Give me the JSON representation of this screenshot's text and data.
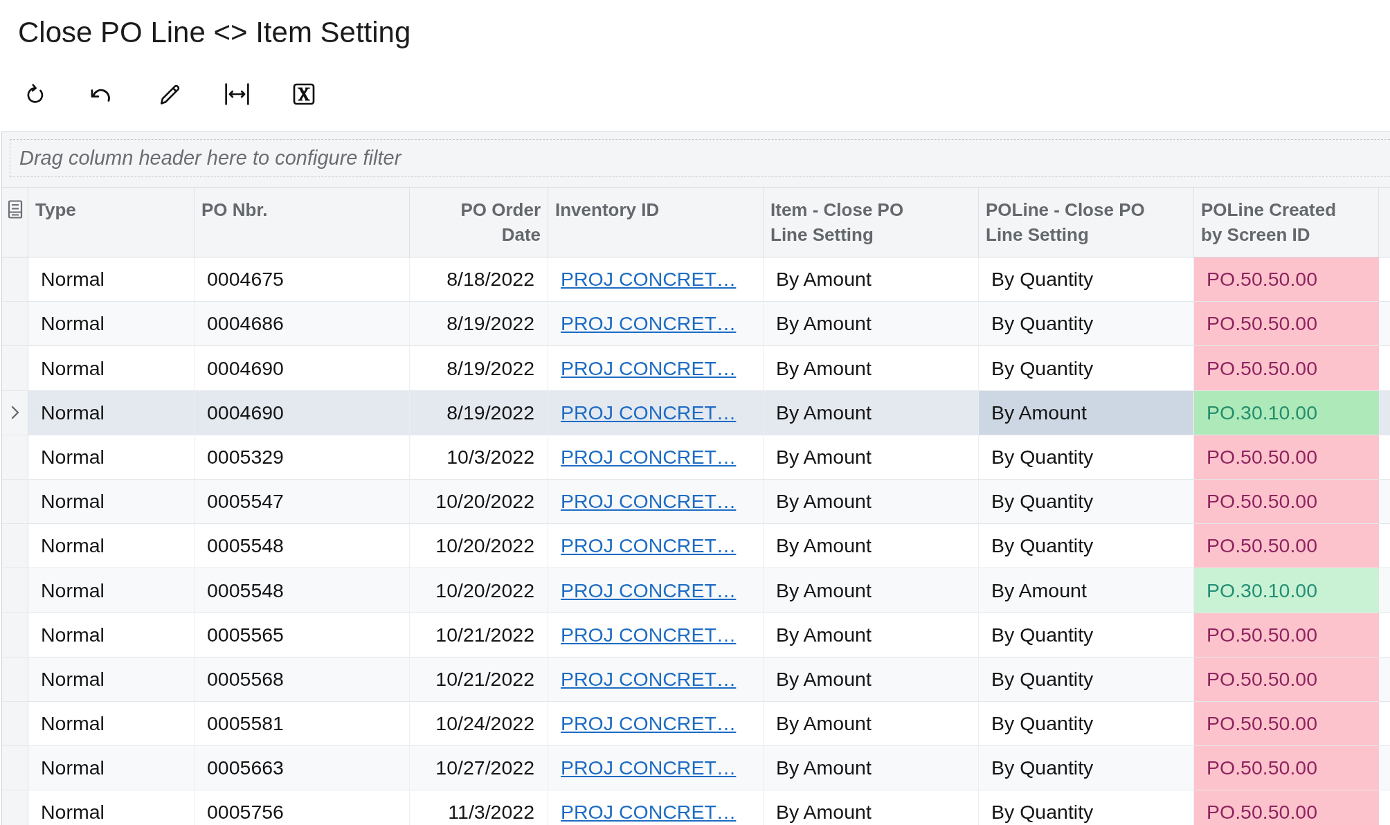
{
  "page": {
    "title": "Close PO Line <> Item Setting"
  },
  "filter_bar": {
    "hint": "Drag column header here to configure filter"
  },
  "grid": {
    "columns": [
      "Type",
      "PO Nbr.",
      "PO Order Date",
      "Inventory ID",
      "Item - Close PO Line Setting",
      "POLine - Close PO Line Setting",
      "POLine Created by Screen ID"
    ],
    "rows": [
      {
        "selected": false,
        "type": "Normal",
        "po_nbr": "0004675",
        "po_order_date": "8/18/2022",
        "inventory_id": "PROJ CONCRET…",
        "item_close_setting": "By Amount",
        "poline_close_setting": "By Quantity",
        "poline_close_focused": false,
        "screen_id": "PO.50.50.00",
        "color": "#fdc3cc"
      },
      {
        "selected": false,
        "type": "Normal",
        "po_nbr": "0004686",
        "po_order_date": "8/19/2022",
        "inventory_id": "PROJ CONCRET…",
        "item_close_setting": "By Amount",
        "poline_close_setting": "By Quantity",
        "poline_close_focused": false,
        "screen_id": "PO.50.50.00",
        "color": "#fdc3cc"
      },
      {
        "selected": false,
        "type": "Normal",
        "po_nbr": "0004690",
        "po_order_date": "8/19/2022",
        "inventory_id": "PROJ CONCRET…",
        "item_close_setting": "By Amount",
        "poline_close_setting": "By Quantity",
        "poline_close_focused": false,
        "screen_id": "PO.50.50.00",
        "color": "#fdc3cc"
      },
      {
        "selected": true,
        "type": "Normal",
        "po_nbr": "0004690",
        "po_order_date": "8/19/2022",
        "inventory_id": "PROJ CONCRET…",
        "item_close_setting": "By Amount",
        "poline_close_setting": "By Amount",
        "poline_close_focused": true,
        "screen_id": "PO.30.10.00",
        "color": "#aeeab9"
      },
      {
        "selected": false,
        "type": "Normal",
        "po_nbr": "0005329",
        "po_order_date": "10/3/2022",
        "inventory_id": "PROJ CONCRET…",
        "item_close_setting": "By Amount",
        "poline_close_setting": "By Quantity",
        "poline_close_focused": false,
        "screen_id": "PO.50.50.00",
        "color": "#fdc3cc"
      },
      {
        "selected": false,
        "type": "Normal",
        "po_nbr": "0005547",
        "po_order_date": "10/20/2022",
        "inventory_id": "PROJ CONCRET…",
        "item_close_setting": "By Amount",
        "poline_close_setting": "By Quantity",
        "poline_close_focused": false,
        "screen_id": "PO.50.50.00",
        "color": "#fdc3cc"
      },
      {
        "selected": false,
        "type": "Normal",
        "po_nbr": "0005548",
        "po_order_date": "10/20/2022",
        "inventory_id": "PROJ CONCRET…",
        "item_close_setting": "By Amount",
        "poline_close_setting": "By Quantity",
        "poline_close_focused": false,
        "screen_id": "PO.50.50.00",
        "color": "#fdc3cc"
      },
      {
        "selected": false,
        "type": "Normal",
        "po_nbr": "0005548",
        "po_order_date": "10/20/2022",
        "inventory_id": "PROJ CONCRET…",
        "item_close_setting": "By Amount",
        "poline_close_setting": "By Amount",
        "poline_close_focused": false,
        "screen_id": "PO.30.10.00",
        "color": "#c8f2d3"
      },
      {
        "selected": false,
        "type": "Normal",
        "po_nbr": "0005565",
        "po_order_date": "10/21/2022",
        "inventory_id": "PROJ CONCRET…",
        "item_close_setting": "By Amount",
        "poline_close_setting": "By Quantity",
        "poline_close_focused": false,
        "screen_id": "PO.50.50.00",
        "color": "#fdc3cc"
      },
      {
        "selected": false,
        "type": "Normal",
        "po_nbr": "0005568",
        "po_order_date": "10/21/2022",
        "inventory_id": "PROJ CONCRET…",
        "item_close_setting": "By Amount",
        "poline_close_setting": "By Quantity",
        "poline_close_focused": false,
        "screen_id": "PO.50.50.00",
        "color": "#fdc3cc"
      },
      {
        "selected": false,
        "type": "Normal",
        "po_nbr": "0005581",
        "po_order_date": "10/24/2022",
        "inventory_id": "PROJ CONCRET…",
        "item_close_setting": "By Amount",
        "poline_close_setting": "By Quantity",
        "poline_close_focused": false,
        "screen_id": "PO.50.50.00",
        "color": "#fdc3cc"
      },
      {
        "selected": false,
        "type": "Normal",
        "po_nbr": "0005663",
        "po_order_date": "10/27/2022",
        "inventory_id": "PROJ CONCRET…",
        "item_close_setting": "By Amount",
        "poline_close_setting": "By Quantity",
        "poline_close_focused": false,
        "screen_id": "PO.50.50.00",
        "color": "#fdc3cc"
      },
      {
        "selected": false,
        "type": "Normal",
        "po_nbr": "0005756",
        "po_order_date": "11/3/2022",
        "inventory_id": "PROJ CONCRET…",
        "item_close_setting": "By Amount",
        "poline_close_setting": "By Quantity",
        "poline_close_focused": false,
        "screen_id": "PO.50.50.00",
        "color": "#fdc3cc"
      }
    ]
  }
}
